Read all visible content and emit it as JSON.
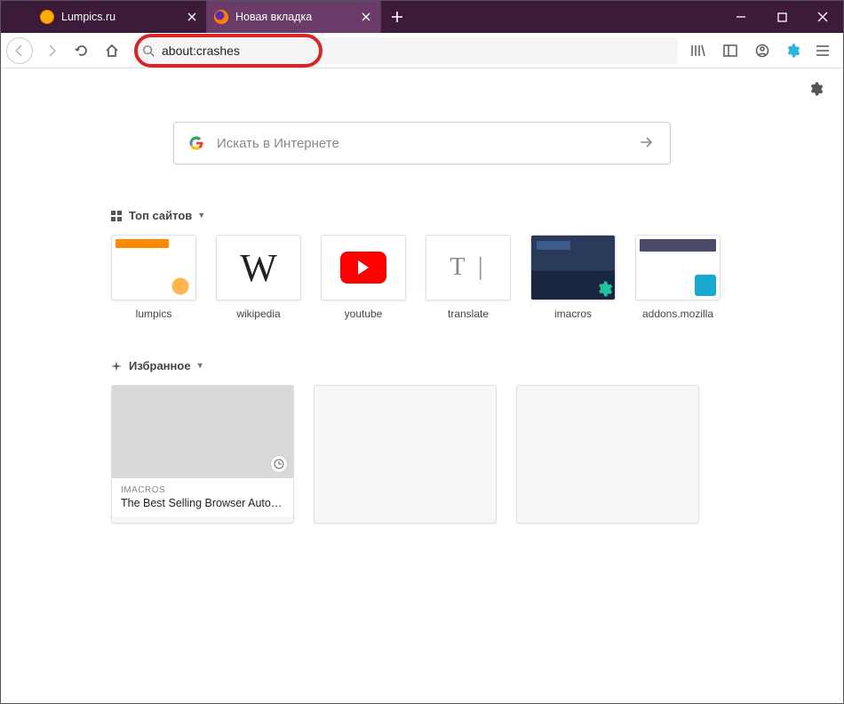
{
  "tabs": [
    {
      "label": "Lumpics.ru",
      "active": false
    },
    {
      "label": "Новая вкладка",
      "active": true
    }
  ],
  "urlbar": {
    "value": "about:crashes"
  },
  "search": {
    "placeholder": "Искать в Интернете"
  },
  "sections": {
    "topsites_label": "Топ сайтов",
    "highlights_label": "Избранное"
  },
  "topsites": [
    {
      "label": "lumpics"
    },
    {
      "label": "wikipedia",
      "glyph": "W"
    },
    {
      "label": "youtube"
    },
    {
      "label": "translate",
      "glyph": "T |"
    },
    {
      "label": "imacros"
    },
    {
      "label": "addons.mozilla"
    }
  ],
  "highlights": [
    {
      "source": "IMACROS",
      "title": "The Best Selling Browser Automati…"
    }
  ]
}
